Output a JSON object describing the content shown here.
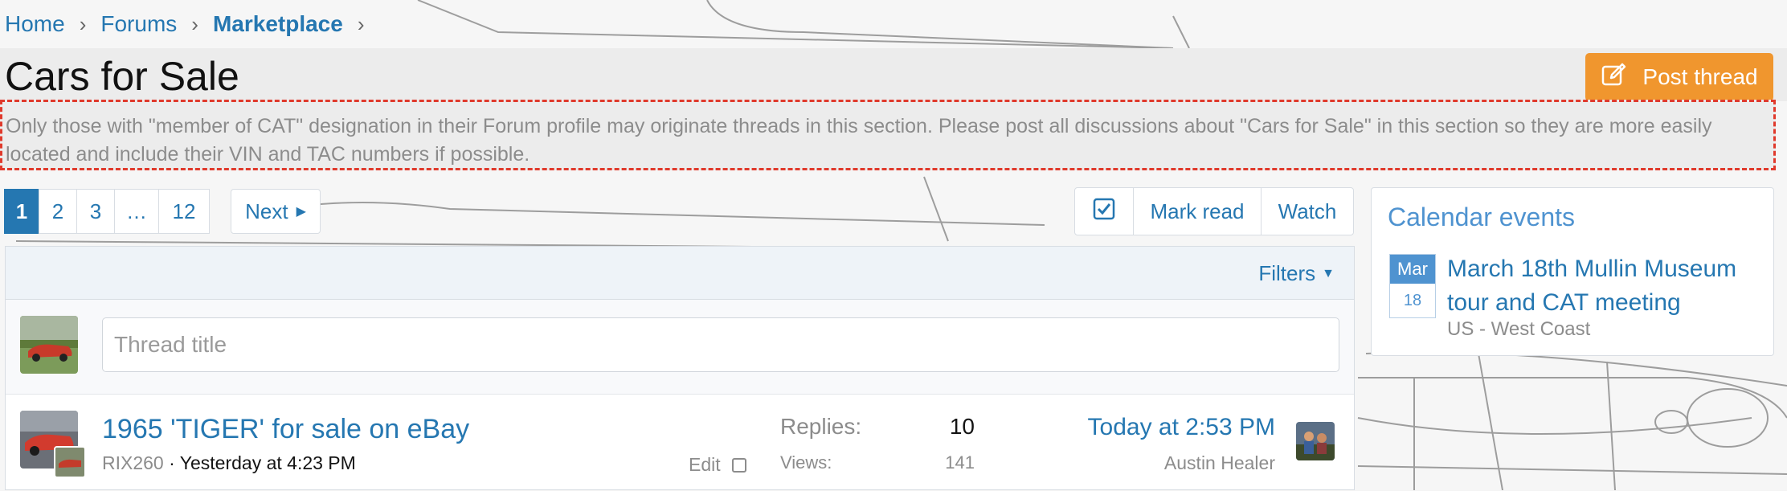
{
  "breadcrumb": [
    {
      "label": "Home"
    },
    {
      "label": "Forums"
    },
    {
      "label": "Marketplace"
    }
  ],
  "page": {
    "title": "Cars for Sale",
    "post_button": "Post thread",
    "description": "Only those with \"member of CAT\" designation in their Forum profile may originate threads in this section. Please post all discussions about \"Cars for Sale\" in this section so they are more easily located and include their VIN and TAC numbers if possible."
  },
  "pagination": {
    "pages": [
      "1",
      "2",
      "3",
      "…",
      "12"
    ],
    "current": "1",
    "next_label": "Next"
  },
  "actions": {
    "mark_read": "Mark read",
    "watch": "Watch"
  },
  "thread_list": {
    "filters_label": "Filters",
    "new_thread_placeholder": "Thread title",
    "threads": [
      {
        "title": "1965 'TIGER' for sale on eBay",
        "author": "RIX260",
        "started": "Yesterday at 4:23 PM",
        "edit_label": "Edit",
        "replies_label": "Replies:",
        "replies": "10",
        "views_label": "Views:",
        "views": "141",
        "last_post_time": "Today at 2:53 PM",
        "last_post_user": "Austin Healer"
      }
    ]
  },
  "calendar": {
    "heading": "Calendar events",
    "events": [
      {
        "month": "Mar",
        "day": "18",
        "title": "March 18th Mullin Museum tour and CAT meeting",
        "location": "US - West Coast"
      }
    ]
  },
  "colors": {
    "accent": "#2577b1",
    "post_button": "#f0962e",
    "calendar_accent": "#4f93d0",
    "highlight_border": "#e03a2c"
  }
}
